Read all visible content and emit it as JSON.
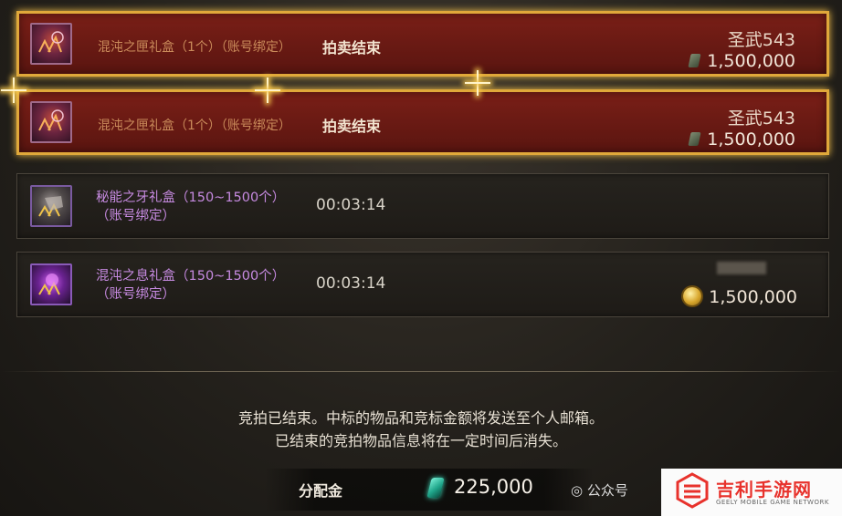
{
  "auction_items": [
    {
      "name": "混沌之匣礼盒（1个）（账号绑定）",
      "status": "拍卖结束",
      "winner": "圣武543",
      "price": "1,500,000"
    },
    {
      "name": "混沌之匣礼盒（1个）（账号绑定）",
      "status": "拍卖结束",
      "winner": "圣武543",
      "price": "1,500,000"
    },
    {
      "name_line1": "秘能之牙礼盒（150~1500个）",
      "name_line2": "（账号绑定）",
      "timer": "00:03:14"
    },
    {
      "name_line1": "混沌之息礼盒（150~1500个）",
      "name_line2": "（账号绑定）",
      "timer": "00:03:14",
      "price": "1,500,000"
    }
  ],
  "notice": {
    "line1": "竞拍已结束。中标的物品和竞标金额将发送至个人邮箱。",
    "line2": "已结束的竞拍物品信息将在一定时间后消失。"
  },
  "distribution": {
    "label": "分配金",
    "value": "225,000"
  },
  "watermark": {
    "left_text": "公众号",
    "logo_cn": "吉利手游网",
    "logo_en": "GEELY MOBILE GAME NETWORK"
  },
  "colors": {
    "won_row_bg": "#6b1a14",
    "won_row_border": "#e0a83a",
    "item_name_orange": "#c98a5a",
    "item_name_purple": "#c68ae0",
    "watermark_red": "#e8322c"
  }
}
